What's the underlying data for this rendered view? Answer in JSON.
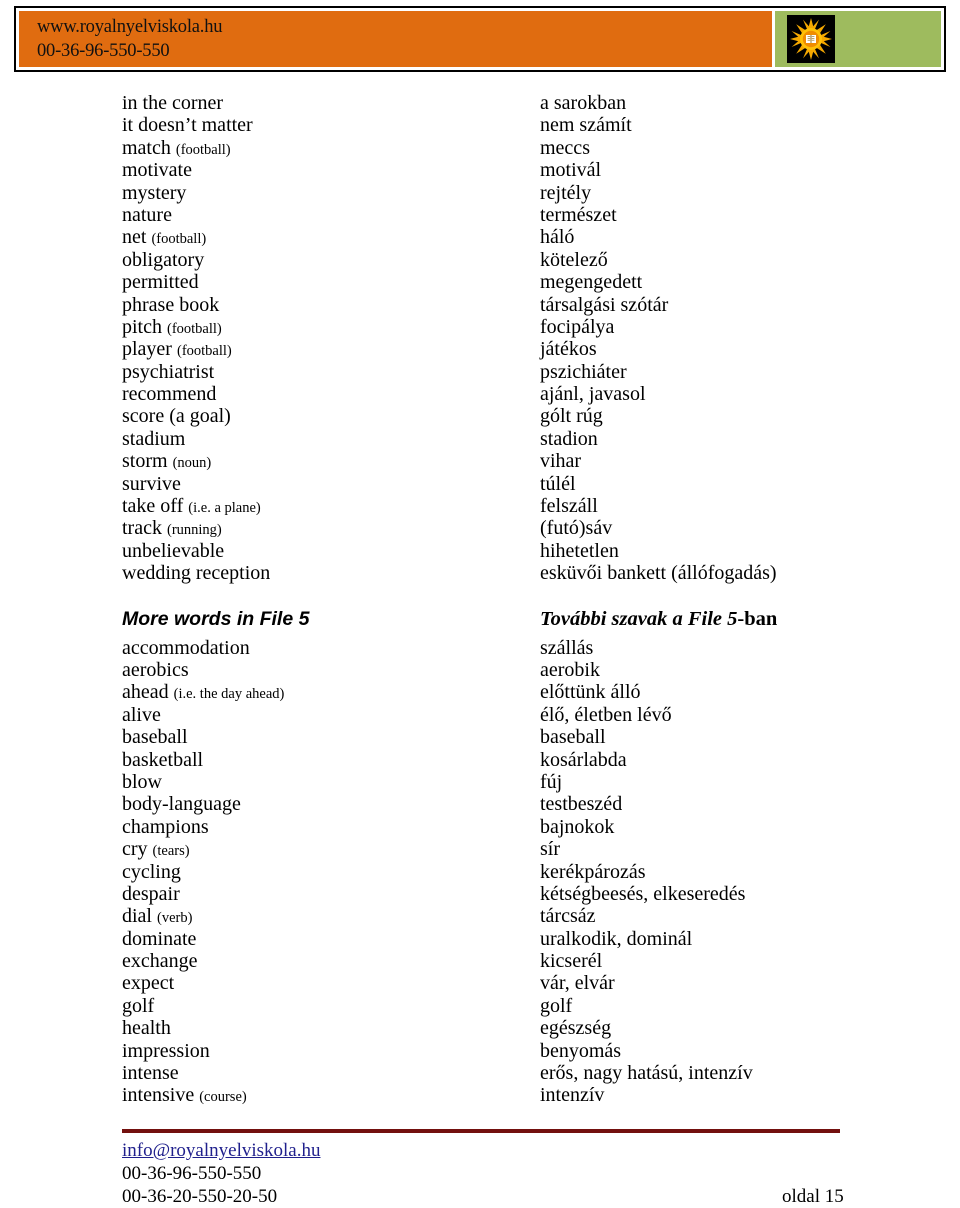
{
  "header": {
    "website": "www.royalnyelviskola.hu",
    "phone": "00-36-96-550-550",
    "logo_icon": "sun-book-logo-icon",
    "colors": {
      "orange": "#E06C10",
      "green": "#9EBB5E",
      "border": "#000000"
    }
  },
  "section1": {
    "rows": [
      {
        "en": "in the corner",
        "en_note": "",
        "hu": "a sarokban"
      },
      {
        "en": "it doesn’t matter",
        "en_note": "",
        "hu": "nem számít"
      },
      {
        "en": "match",
        "en_note": "(football)",
        "hu": "meccs"
      },
      {
        "en": "motivate",
        "en_note": "",
        "hu": "motivál"
      },
      {
        "en": "mystery",
        "en_note": "",
        "hu": "rejtély"
      },
      {
        "en": "nature",
        "en_note": "",
        "hu": "természet"
      },
      {
        "en": "net",
        "en_note": "(football)",
        "hu": "háló"
      },
      {
        "en": "obligatory",
        "en_note": "",
        "hu": "kötelező"
      },
      {
        "en": "permitted",
        "en_note": "",
        "hu": "megengedett"
      },
      {
        "en": "phrase book",
        "en_note": "",
        "hu": "társalgási szótár"
      },
      {
        "en": "pitch",
        "en_note": "(football)",
        "hu": "focipálya"
      },
      {
        "en": "player",
        "en_note": "(football)",
        "hu": "játékos"
      },
      {
        "en": "psychiatrist",
        "en_note": "",
        "hu": "pszichiáter"
      },
      {
        "en": "recommend",
        "en_note": "",
        "hu": "ajánl, javasol"
      },
      {
        "en": "score (a goal)",
        "en_note": "",
        "hu": "gólt rúg"
      },
      {
        "en": "stadium",
        "en_note": "",
        "hu": "stadion"
      },
      {
        "en": "storm",
        "en_note": "(noun)",
        "hu": "vihar"
      },
      {
        "en": "survive",
        "en_note": "",
        "hu": "túlél"
      },
      {
        "en": "take off",
        "en_note": "(i.e. a plane)",
        "hu": "felszáll"
      },
      {
        "en": "track",
        "en_note": "(running)",
        "hu": "(futó)sáv"
      },
      {
        "en": "unbelievable",
        "en_note": "",
        "hu": "hihetetlen"
      },
      {
        "en": "wedding reception",
        "en_note": "",
        "hu": "esküvői bankett (állófogadás)"
      }
    ]
  },
  "section2": {
    "heading_en": "More words in File 5",
    "heading_hu_italic": "További szavak a File 5",
    "heading_hu_suffix": "-ban",
    "rows": [
      {
        "en": "accommodation",
        "en_note": "",
        "hu": "szállás"
      },
      {
        "en": "aerobics",
        "en_note": "",
        "hu": "aerobik"
      },
      {
        "en": "ahead",
        "en_note": "(i.e. the day ahead)",
        "hu": "előttünk álló"
      },
      {
        "en": "alive",
        "en_note": "",
        "hu": "élő, életben lévő"
      },
      {
        "en": "baseball",
        "en_note": "",
        "hu": "baseball"
      },
      {
        "en": "basketball",
        "en_note": "",
        "hu": "kosárlabda"
      },
      {
        "en": "blow",
        "en_note": "",
        "hu": "fúj"
      },
      {
        "en": "body-language",
        "en_note": "",
        "hu": "testbeszéd"
      },
      {
        "en": "champions",
        "en_note": "",
        "hu": "bajnokok"
      },
      {
        "en": "cry",
        "en_note": "(tears)",
        "hu": "sír"
      },
      {
        "en": "cycling",
        "en_note": "",
        "hu": "kerékpározás"
      },
      {
        "en": "despair",
        "en_note": "",
        "hu": "kétségbeesés, elkeseredés"
      },
      {
        "en": "dial",
        "en_note": "(verb)",
        "hu": "tárcsáz"
      },
      {
        "en": "dominate",
        "en_note": "",
        "hu": "uralkodik, dominál"
      },
      {
        "en": "exchange",
        "en_note": "",
        "hu": "kicserél"
      },
      {
        "en": "expect",
        "en_note": "",
        "hu": "vár, elvár"
      },
      {
        "en": "golf",
        "en_note": "",
        "hu": "golf"
      },
      {
        "en": "health",
        "en_note": "",
        "hu": "egészség"
      },
      {
        "en": "impression",
        "en_note": "",
        "hu": "benyomás"
      },
      {
        "en": "intense",
        "en_note": "",
        "hu": "erős, nagy hatású, intenzív"
      },
      {
        "en": "intensive",
        "en_note": "(course)",
        "hu": "intenzív"
      }
    ]
  },
  "footer": {
    "email": "info@royalnyelviskola.hu",
    "phone1": "00-36-96-550-550",
    "phone2": "00-36-20-550-20-50",
    "page": "oldal 15",
    "rule_color": "#73100E",
    "link_color": "#1F1F8C"
  }
}
